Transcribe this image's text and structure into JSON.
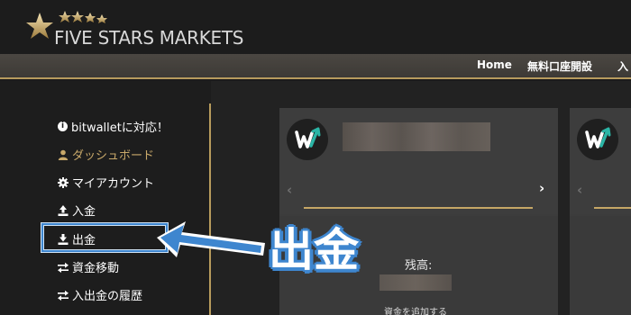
{
  "header": {
    "brand": "FIVE STARS MARKETS",
    "nav": [
      {
        "label": "Home"
      },
      {
        "label": "無料口座開設"
      },
      {
        "label": "入"
      }
    ]
  },
  "sidebar": {
    "items": [
      {
        "label": "bitwalletに対応！",
        "icon": "info-icon"
      },
      {
        "label": "ダッシュボード",
        "icon": "user-icon",
        "active": true
      },
      {
        "label": "マイアカウント",
        "icon": "gear-icon"
      },
      {
        "label": "入金",
        "icon": "upload-icon"
      },
      {
        "label": "出金",
        "icon": "download-icon",
        "highlighted": true
      },
      {
        "label": "資金移動",
        "icon": "transfer-icon"
      },
      {
        "label": "入出金の履歴",
        "icon": "transfer-icon"
      }
    ]
  },
  "cards": [
    {
      "balance_label": "残高:",
      "add_link": "資金を追加する"
    }
  ],
  "callout": {
    "text": "出金"
  },
  "colors": {
    "accent_gold": "#c6a766",
    "highlight_blue": "#3e86cf",
    "bitwallet_teal": "#2bb5a6"
  }
}
